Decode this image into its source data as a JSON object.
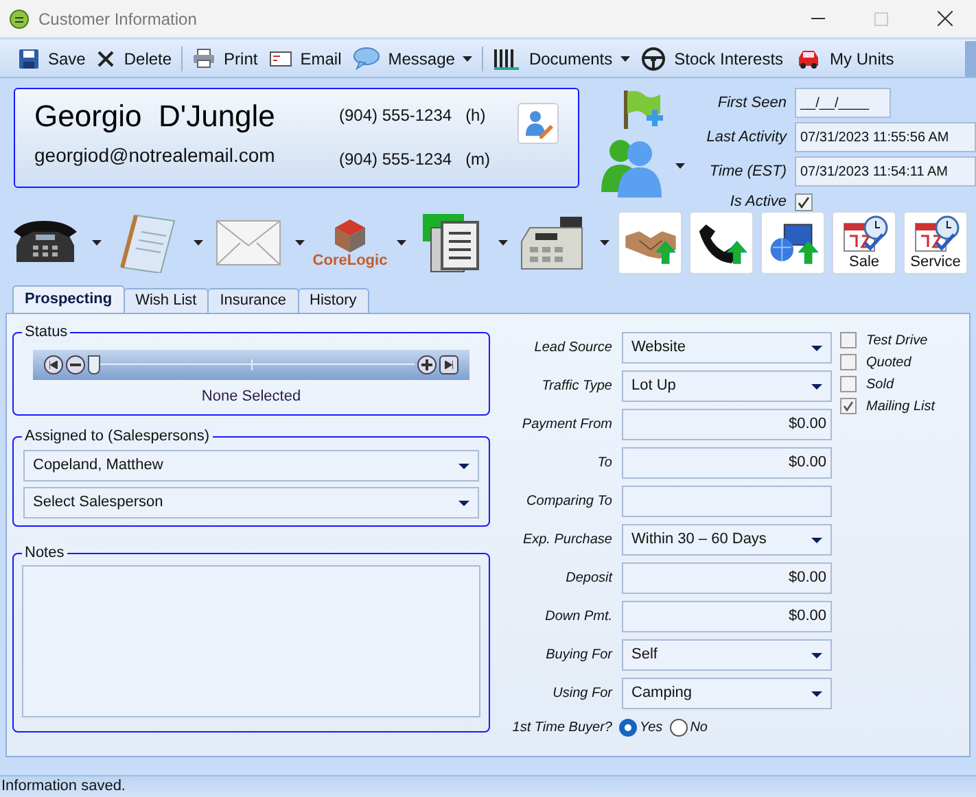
{
  "window": {
    "title": "Customer Information"
  },
  "toolbar": [
    {
      "label": "Save",
      "dropdown": false
    },
    {
      "label": "Delete",
      "dropdown": false
    },
    {
      "label": "Print",
      "dropdown": false
    },
    {
      "label": "Email",
      "dropdown": false
    },
    {
      "label": "Message",
      "dropdown": true
    },
    {
      "label": "Documents",
      "dropdown": true
    },
    {
      "label": "Stock Interests",
      "dropdown": false
    },
    {
      "label": "My Units",
      "dropdown": false
    }
  ],
  "contact": {
    "first_name": "Georgio",
    "last_name": "D'Jungle",
    "email": "georgiod@notrealemail.com",
    "phones": [
      {
        "number": "(904) 555-1234",
        "type": "(h)"
      },
      {
        "number": "(904) 555-1234",
        "type": "(m)"
      }
    ]
  },
  "dates": [
    {
      "label": "First Seen",
      "value": "__/__/____"
    },
    {
      "label": "Last Activity",
      "value": "07/31/2023 11:55:56 AM"
    },
    {
      "label": "Time (EST)",
      "value": "07/31/2023 11:54:11 AM"
    }
  ],
  "is_active": {
    "label": "Is Active",
    "checked": true
  },
  "action_menus": [
    {
      "kind": "phone"
    },
    {
      "kind": "note"
    },
    {
      "kind": "envelope"
    },
    {
      "kind": "corelogic",
      "label": "CoreLogic"
    },
    {
      "kind": "documents"
    },
    {
      "kind": "register"
    }
  ],
  "action_buttons": [
    {
      "kind": "handshake"
    },
    {
      "kind": "call"
    },
    {
      "kind": "web"
    },
    {
      "kind": "calendar",
      "label": "Sale"
    },
    {
      "kind": "calendar",
      "label": "Service"
    }
  ],
  "tabs": [
    {
      "label": "Prospecting",
      "selected": true
    },
    {
      "label": "Wish List",
      "selected": false
    },
    {
      "label": "Insurance",
      "selected": false
    },
    {
      "label": "History",
      "selected": false
    }
  ],
  "status": {
    "label": "Status",
    "level": 0,
    "text": "None Selected"
  },
  "assigned": {
    "label": "Assigned to (Salespersons)",
    "selects": [
      "Copeland, Matthew",
      "Select Salesperson"
    ]
  },
  "notes": {
    "label": "Notes"
  },
  "fields": [
    {
      "label": "Lead Source",
      "kind": "select",
      "value": "Website"
    },
    {
      "label": "Traffic Type",
      "kind": "select",
      "value": "Lot Up"
    },
    {
      "label": "Payment From",
      "kind": "money",
      "value": "$0.00"
    },
    {
      "label": "To",
      "kind": "money",
      "value": "$0.00"
    },
    {
      "label": "Comparing To",
      "kind": "text"
    },
    {
      "label": "Exp. Purchase",
      "kind": "select",
      "value": "Within 30 – 60 Days"
    },
    {
      "label": "Deposit",
      "kind": "money",
      "value": "$0.00"
    },
    {
      "label": "Down Pmt.",
      "kind": "money",
      "value": "$0.00"
    },
    {
      "label": "Buying For",
      "kind": "select",
      "value": "Self"
    },
    {
      "label": "Using For",
      "kind": "select",
      "value": "Camping"
    }
  ],
  "checkboxes": [
    {
      "label": "Test Drive",
      "checked": false
    },
    {
      "label": "Quoted",
      "checked": false
    },
    {
      "label": "Sold",
      "checked": false
    },
    {
      "label": "Mailing List",
      "checked": true
    }
  ],
  "first_time_buyer": {
    "label": "1st Time Buyer?",
    "options": [
      {
        "label": "Yes",
        "selected": true
      },
      {
        "label": "No",
        "selected": false
      }
    ]
  },
  "status_bar": "Information saved."
}
